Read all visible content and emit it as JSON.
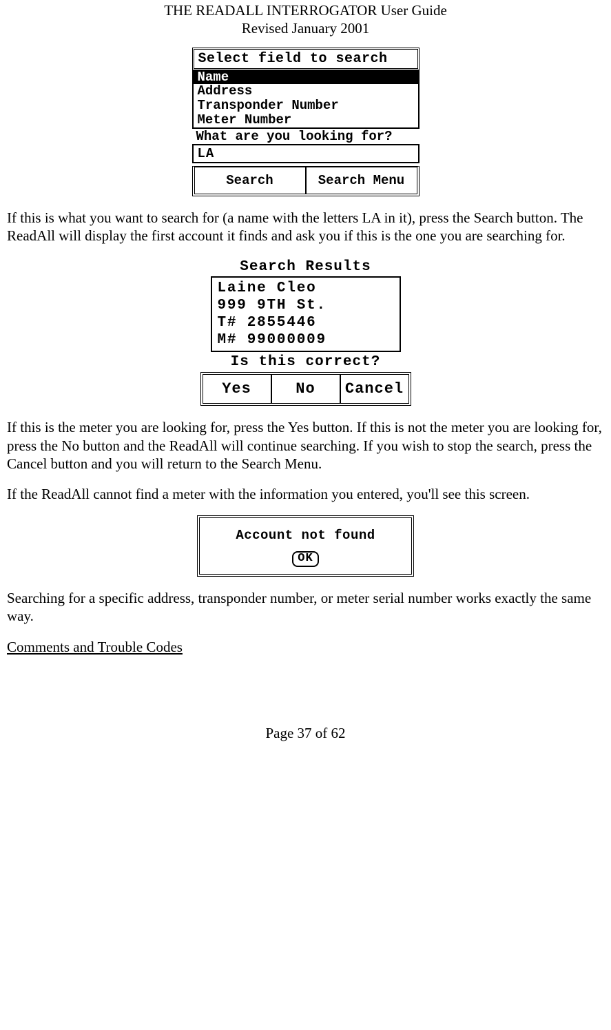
{
  "header": {
    "title": "THE READALL INTERROGATOR User Guide",
    "revision": "Revised January 2001"
  },
  "screen1": {
    "title": "Select field to search",
    "options": [
      "Name",
      "Address",
      "Transponder Number",
      "Meter Number"
    ],
    "selected_index": 0,
    "prompt": "What are you looking for?",
    "input_value": "LA",
    "buttons": {
      "search": "Search",
      "menu": "Search Menu"
    }
  },
  "para1": "If this is what you want to search for (a name with the letters LA in it), press the Search button.  The ReadAll will display the first account it finds and ask you if this is the one you are searching for.",
  "screen2": {
    "title": "Search Results",
    "result": {
      "name": "Laine Cleo",
      "address": "999 9TH St.",
      "t_line": "T# 2855446",
      "m_line": "M# 99000009"
    },
    "prompt": "Is this correct?",
    "buttons": {
      "yes": "Yes",
      "no": "No",
      "cancel": "Cancel"
    }
  },
  "para2": "If this is the meter you are looking for, press the Yes button.  If this is not the meter you are looking for, press the No button and the ReadAll will continue searching.  If you wish to stop the search, press the Cancel button and you will return to the Search Menu.",
  "para3": "If the ReadAll cannot find a meter with the information you entered, you'll see this screen.",
  "screen3": {
    "message": "Account not found",
    "ok": "OK"
  },
  "para4": "Searching for a specific address, transponder number, or meter serial number works exactly the same way.",
  "section_heading": "Comments and Trouble Codes",
  "footer": "Page 37 of 62"
}
